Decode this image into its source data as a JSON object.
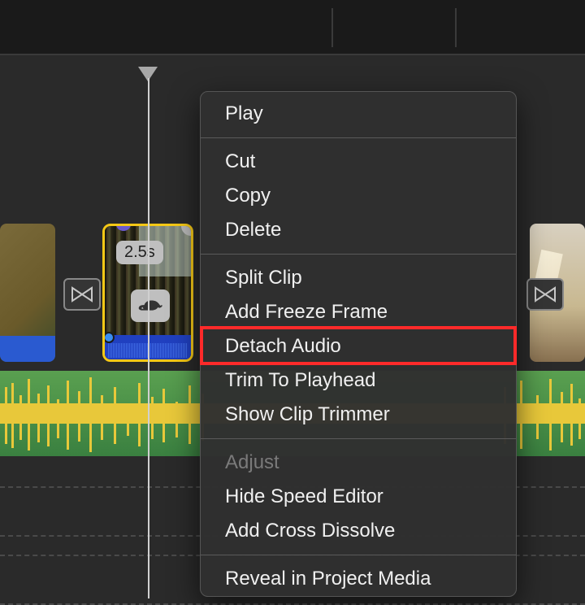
{
  "clip": {
    "duration_label": "2.5s"
  },
  "menu": {
    "play": "Play",
    "cut": "Cut",
    "copy": "Copy",
    "delete": "Delete",
    "split_clip": "Split Clip",
    "add_freeze_frame": "Add Freeze Frame",
    "detach_audio": "Detach Audio",
    "trim_to_playhead": "Trim To Playhead",
    "show_clip_trimmer": "Show Clip Trimmer",
    "adjust": "Adjust",
    "hide_speed_editor": "Hide Speed Editor",
    "add_cross_dissolve": "Add Cross Dissolve",
    "reveal_in_project_media": "Reveal in Project Media"
  }
}
